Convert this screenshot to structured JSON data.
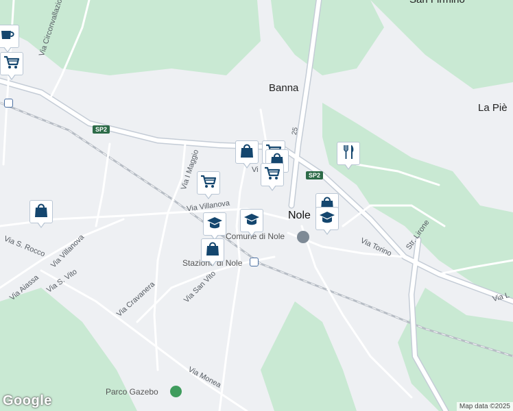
{
  "map": {
    "colors": {
      "land": "#eef0f3",
      "green": "#c9e9d3",
      "major_road": "#ffffff",
      "road_casing": "#c4ccd6",
      "rail": "#b7bdc5",
      "marker_icon": "#14466e"
    },
    "places": {
      "banna": "Banna",
      "la_pie": "La Piè",
      "san_firmino": "San Firmino",
      "nole": "Nole"
    },
    "roads": {
      "via_circonvallazione": "Via Circonvallazione",
      "via_i_maggio": "Via I Maggio",
      "via_villanova_center": "Via Villanova",
      "via_villanova_west": "Via Villanova",
      "via_s_rocco": "Via S. Rocco",
      "via_alassa": "Via Aiassa",
      "via_s_vito": "Via S. Vito",
      "via_cravanera": "Via Cravanera",
      "via_san_vito": "Via San Vito",
      "via_torino": "Via Torino",
      "str_lirone": "Str. Lirone",
      "via_l_right": "Via L",
      "via_monea": "Via Monea",
      "vi_fragment": "Vi"
    },
    "shields": {
      "sp2_west": "SP2",
      "sp2_east": "SP2",
      "sp25_fragment": "25"
    },
    "pois": {
      "comune": "Comune di Nole",
      "stazione": "Stazione di Nole",
      "parco": "Parco Gazebo"
    },
    "markers": [
      {
        "name": "marker-cup-top-left",
        "icon": "cup-icon"
      },
      {
        "name": "marker-cart-top-left",
        "icon": "shopping-cart-icon"
      },
      {
        "name": "marker-bag-west",
        "icon": "shopping-bag-icon"
      },
      {
        "name": "marker-cart-via-maggio",
        "icon": "shopping-cart-icon"
      },
      {
        "name": "marker-school-villanova",
        "icon": "graduation-cap-icon"
      },
      {
        "name": "marker-bag-stazione",
        "icon": "shopping-bag-icon"
      },
      {
        "name": "marker-school-center",
        "icon": "graduation-cap-icon"
      },
      {
        "name": "marker-bag-center",
        "icon": "shopping-bag-icon"
      },
      {
        "name": "marker-cart-center-back",
        "icon": "shopping-cart-icon"
      },
      {
        "name": "marker-bag-center-2",
        "icon": "shopping-bag-icon"
      },
      {
        "name": "marker-cart-center-front",
        "icon": "shopping-cart-icon"
      },
      {
        "name": "marker-restaurant-east",
        "icon": "fork-knife-icon"
      },
      {
        "name": "marker-bag-nole",
        "icon": "shopping-bag-icon"
      },
      {
        "name": "marker-school-nole",
        "icon": "graduation-cap-icon"
      }
    ],
    "attribution": {
      "logo": "Google",
      "text": "Map data ©2025"
    }
  }
}
